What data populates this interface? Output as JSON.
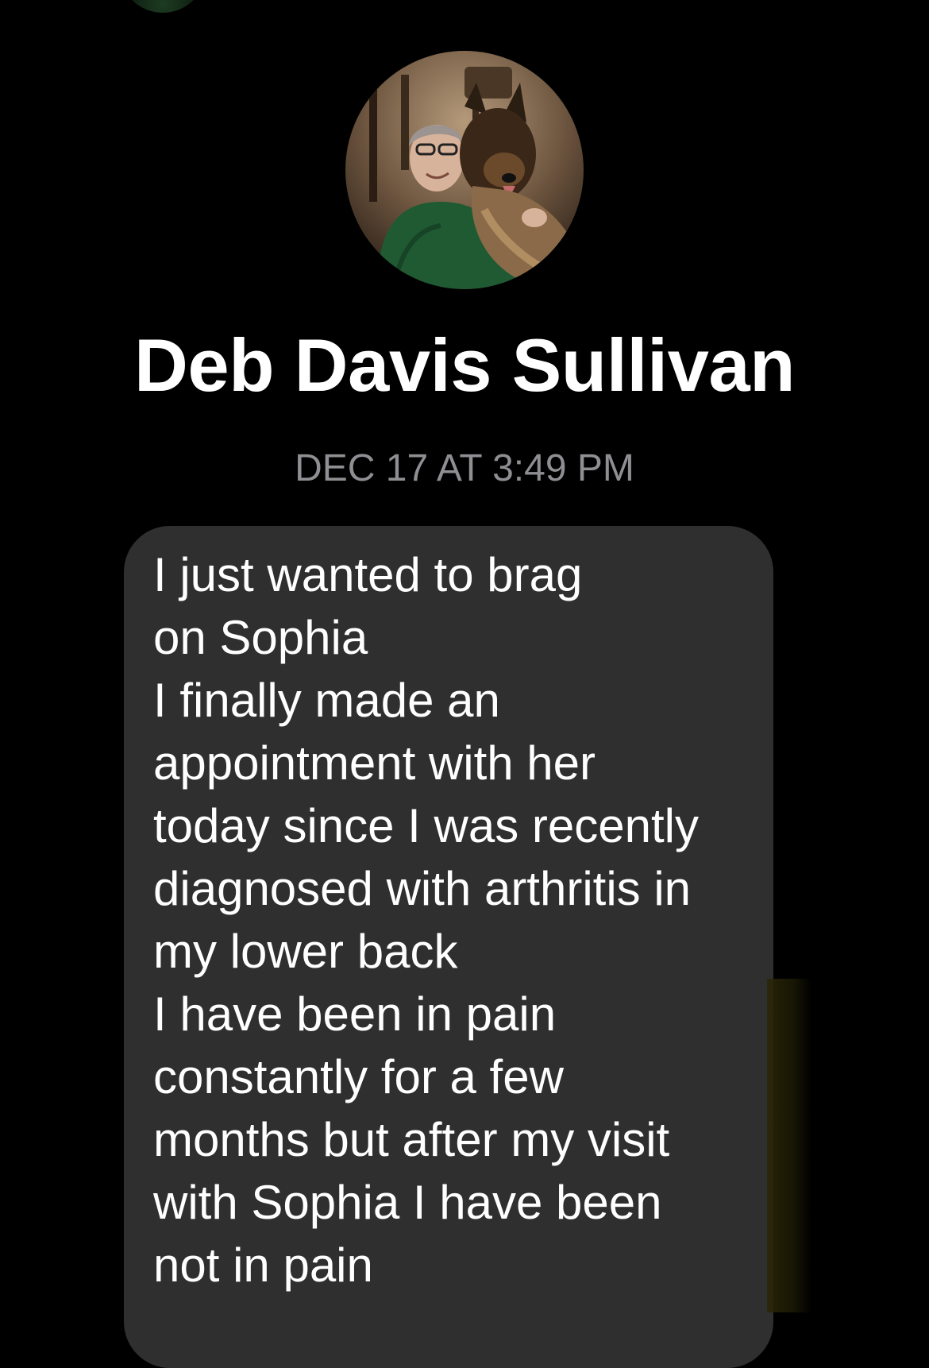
{
  "conversation": {
    "contact_name": "Deb Davis Sullivan",
    "timestamp": "DEC 17 AT 3:49 PM"
  },
  "message": {
    "text": "I just wanted to brag\non Sophia\nI finally made an\nappointment with her\ntoday since I was recently\ndiagnosed with arthritis in\nmy lower back\nI have been in pain\nconstantly for a few\nmonths but after my visit\nwith Sophia I have been\nnot in pain"
  },
  "colors": {
    "background": "#000000",
    "bubble": "#2f2f2f",
    "timestamp": "#8e8e93",
    "text": "#ffffff"
  },
  "icons": {
    "profile_avatar": "avatar-photo-woman-with-dog",
    "corner_avatar": "avatar-photo-thumbnail"
  }
}
